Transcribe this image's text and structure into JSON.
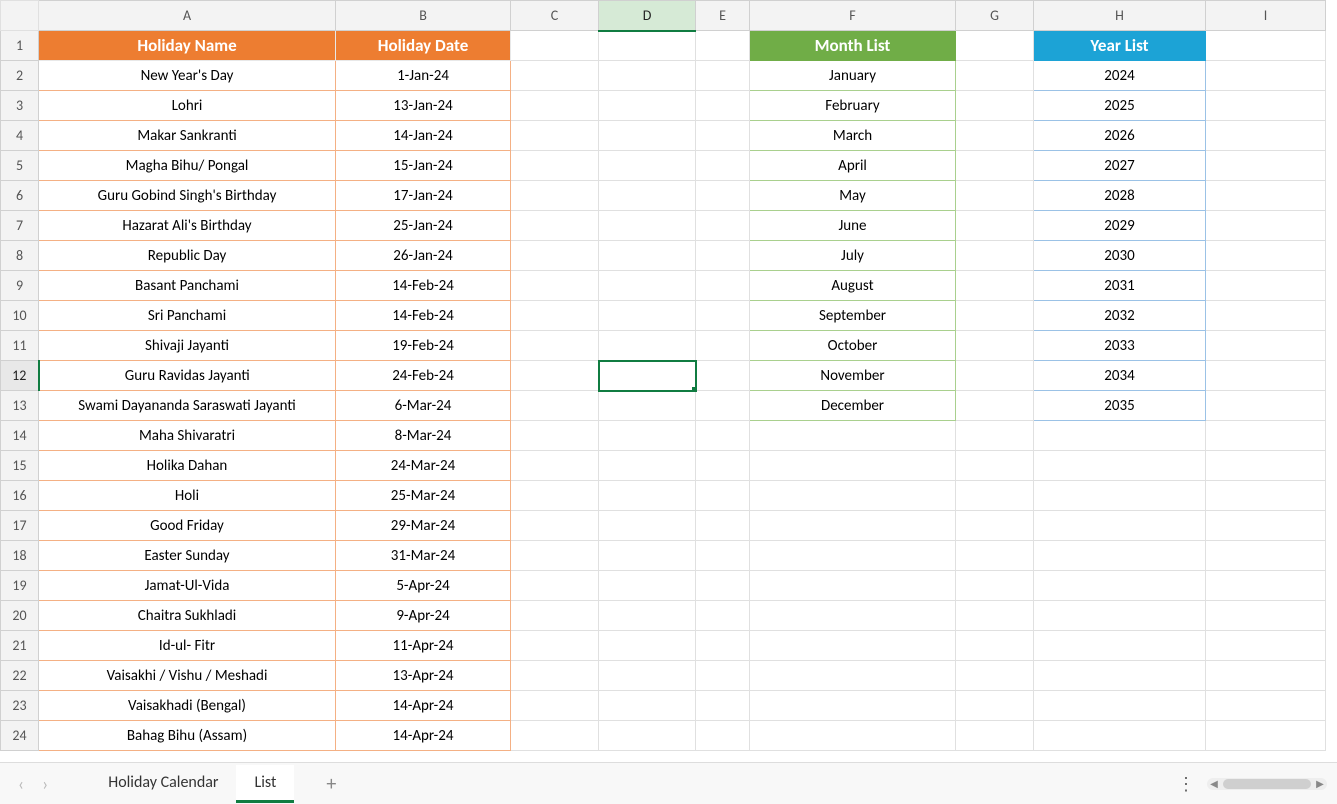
{
  "columns": [
    "A",
    "B",
    "C",
    "D",
    "E",
    "F",
    "G",
    "H",
    "I"
  ],
  "active_column": "D",
  "active_row": 12,
  "selected_cell": {
    "col": "D",
    "row": 12
  },
  "row_count": 24,
  "headers": {
    "A": "Holiday Name",
    "B": "Holiday Date",
    "F": "Month List",
    "H": "Year List"
  },
  "holidays": [
    {
      "name": "New Year's Day",
      "date": "1-Jan-24"
    },
    {
      "name": "Lohri",
      "date": "13-Jan-24"
    },
    {
      "name": "Makar Sankranti",
      "date": "14-Jan-24"
    },
    {
      "name": "Magha Bihu/ Pongal",
      "date": "15-Jan-24"
    },
    {
      "name": "Guru Gobind Singh's Birthday",
      "date": "17-Jan-24"
    },
    {
      "name": "Hazarat Ali's Birthday",
      "date": "25-Jan-24"
    },
    {
      "name": "Republic Day",
      "date": "26-Jan-24"
    },
    {
      "name": "Basant Panchami",
      "date": "14-Feb-24"
    },
    {
      "name": "Sri Panchami",
      "date": "14-Feb-24"
    },
    {
      "name": "Shivaji Jayanti",
      "date": "19-Feb-24"
    },
    {
      "name": "Guru Ravidas Jayanti",
      "date": "24-Feb-24"
    },
    {
      "name": "Swami Dayananda Saraswati Jayanti",
      "date": "6-Mar-24"
    },
    {
      "name": "Maha Shivaratri",
      "date": "8-Mar-24"
    },
    {
      "name": "Holika Dahan",
      "date": "24-Mar-24"
    },
    {
      "name": "Holi",
      "date": "25-Mar-24"
    },
    {
      "name": "Good Friday",
      "date": "29-Mar-24"
    },
    {
      "name": "Easter Sunday",
      "date": "31-Mar-24"
    },
    {
      "name": "Jamat-Ul-Vida",
      "date": "5-Apr-24"
    },
    {
      "name": "Chaitra Sukhladi",
      "date": "9-Apr-24"
    },
    {
      "name": "Id-ul- Fitr",
      "date": "11-Apr-24"
    },
    {
      "name": "Vaisakhi / Vishu / Meshadi",
      "date": "13-Apr-24"
    },
    {
      "name": "Vaisakhadi (Bengal)",
      "date": "14-Apr-24"
    },
    {
      "name": "Bahag Bihu (Assam)",
      "date": "14-Apr-24"
    }
  ],
  "months": [
    "January",
    "February",
    "March",
    "April",
    "May",
    "June",
    "July",
    "August",
    "September",
    "October",
    "November",
    "December"
  ],
  "years": [
    "2024",
    "2025",
    "2026",
    "2027",
    "2028",
    "2029",
    "2030",
    "2031",
    "2032",
    "2033",
    "2034",
    "2035"
  ],
  "tabs": {
    "items": [
      {
        "label": "Holiday Calendar",
        "active": false
      },
      {
        "label": "List",
        "active": true
      }
    ],
    "add_label": "+"
  }
}
